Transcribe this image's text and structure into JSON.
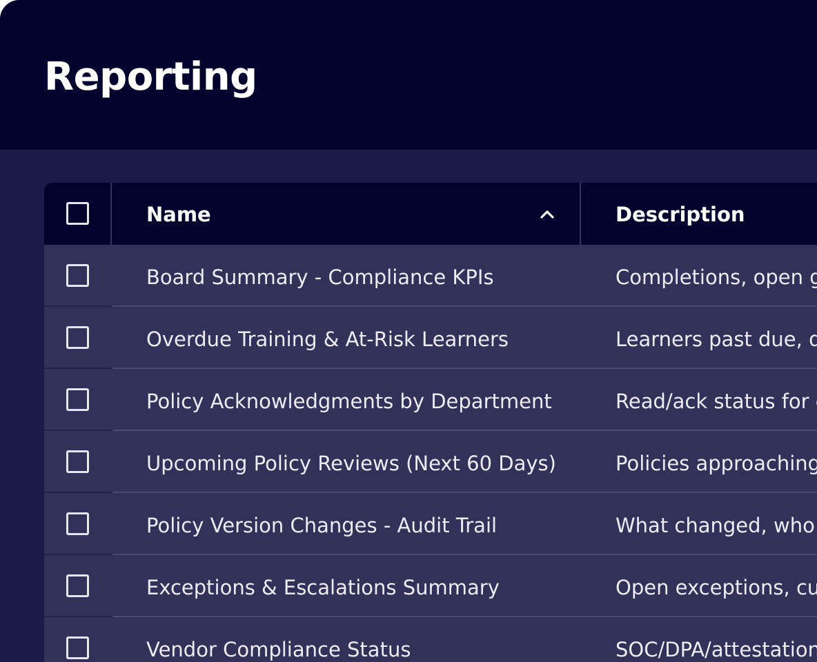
{
  "page": {
    "title": "Reporting"
  },
  "table": {
    "columns": {
      "name": "Name",
      "description": "Description"
    },
    "sort": {
      "column": "name",
      "direction": "ascending",
      "icon": "chevron-up-icon"
    },
    "select_all_checked": false,
    "rows": [
      {
        "name": "Board Summary - Compliance KPIs",
        "description": "Completions, open g",
        "checked": false
      },
      {
        "name": "Overdue Training & At-Risk Learners",
        "description": "Learners past due, d",
        "checked": false
      },
      {
        "name": "Policy Acknowledgments by Department",
        "description": "Read/ack status for e",
        "checked": false
      },
      {
        "name": "Upcoming Policy Reviews (Next 60 Days)",
        "description": "Policies approaching",
        "checked": false
      },
      {
        "name": "Policy Version Changes - Audit Trail",
        "description": "What changed, who a",
        "checked": false
      },
      {
        "name": "Exceptions & Escalations Summary",
        "description": "Open exceptions, cu",
        "checked": false
      },
      {
        "name": "Vendor Compliance Status",
        "description": "SOC/DPA/attestation",
        "checked": false
      }
    ]
  },
  "colors": {
    "header_bg": "#03032e",
    "page_bg": "#1c1b47",
    "table_row_bg": "#32315a",
    "table_header_bg": "#02022c",
    "text": "#ffffff"
  }
}
